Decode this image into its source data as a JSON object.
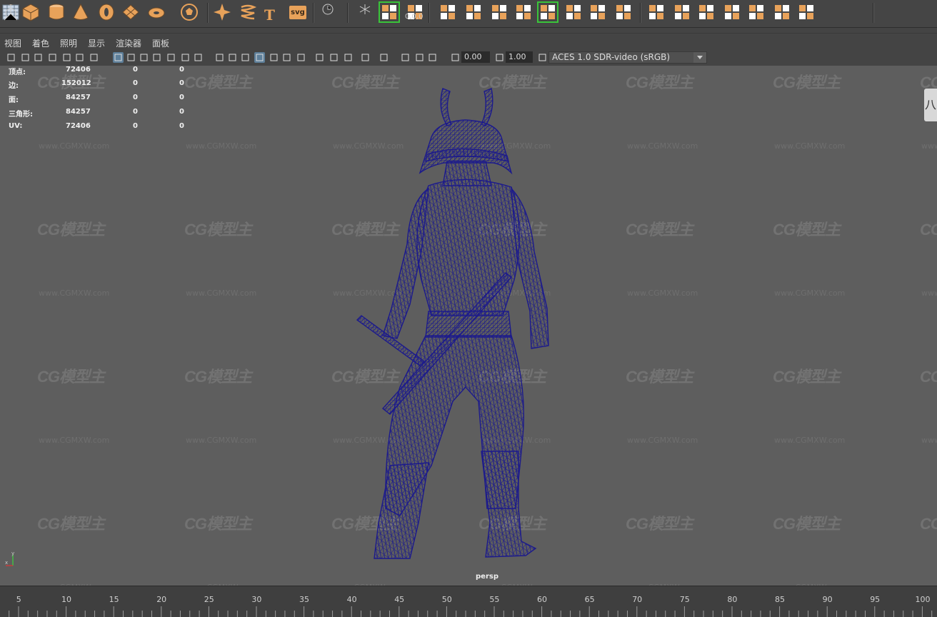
{
  "shelf": {
    "icons": [
      "sphere-icon",
      "cube-icon",
      "cylinder-icon",
      "cone-icon",
      "torus-icon",
      "plane-icon",
      "disc-icon",
      "soccer-ball-icon",
      "star-icon",
      "helix-icon",
      "text-icon",
      "svg-icon",
      "grid-icon",
      "pivot-icon",
      "timer-icon",
      "snowflake-icon",
      "wrap-icon",
      "bridge-icon",
      "extrude-icon",
      "bevel-icon",
      "merge-icon",
      "boolean-icon",
      "loop-icon",
      "mirror-icon",
      "separate-icon",
      "subdivide-icon",
      "transfer-icon",
      "combine-icon",
      "smooth-icon",
      "triangulate-icon",
      "quad-icon",
      "edit-icon",
      "crease-icon"
    ],
    "text_label": "T",
    "svg_label": "svg",
    "snowflake_caption": "0,0,0"
  },
  "panel_menu": [
    "视图",
    "着色",
    "照明",
    "显示",
    "渲染器",
    "面板"
  ],
  "panel_toolbar": {
    "exposure": "0.00",
    "gamma": "1.00",
    "colorspace": "ACES 1.0 SDR-video (sRGB)"
  },
  "hud": {
    "rows": [
      {
        "label": "顶点:",
        "v1": "72406",
        "v2": "0",
        "v3": "0"
      },
      {
        "label": "边:",
        "v1": "152012",
        "v2": "0",
        "v3": "0"
      },
      {
        "label": "面:",
        "v1": "84257",
        "v2": "0",
        "v3": "0"
      },
      {
        "label": "三角形:",
        "v1": "84257",
        "v2": "0",
        "v3": "0"
      },
      {
        "label": "UV:",
        "v1": "72406",
        "v2": "0",
        "v3": "0"
      }
    ]
  },
  "viewport": {
    "camera": "persp",
    "side_tab": "八",
    "watermark_logo": "CG模型主",
    "watermark_url": "www.CGMXW.com",
    "wire_color": "#1c1a8c",
    "background": "#5e5e5e"
  },
  "axis": {
    "x": "x",
    "y": "y"
  },
  "timeline": {
    "ticks": [
      "5",
      "10",
      "15",
      "20",
      "25",
      "30",
      "35",
      "40",
      "45",
      "50",
      "55",
      "60",
      "65",
      "70",
      "75",
      "80",
      "85",
      "90",
      "95",
      "100"
    ]
  }
}
